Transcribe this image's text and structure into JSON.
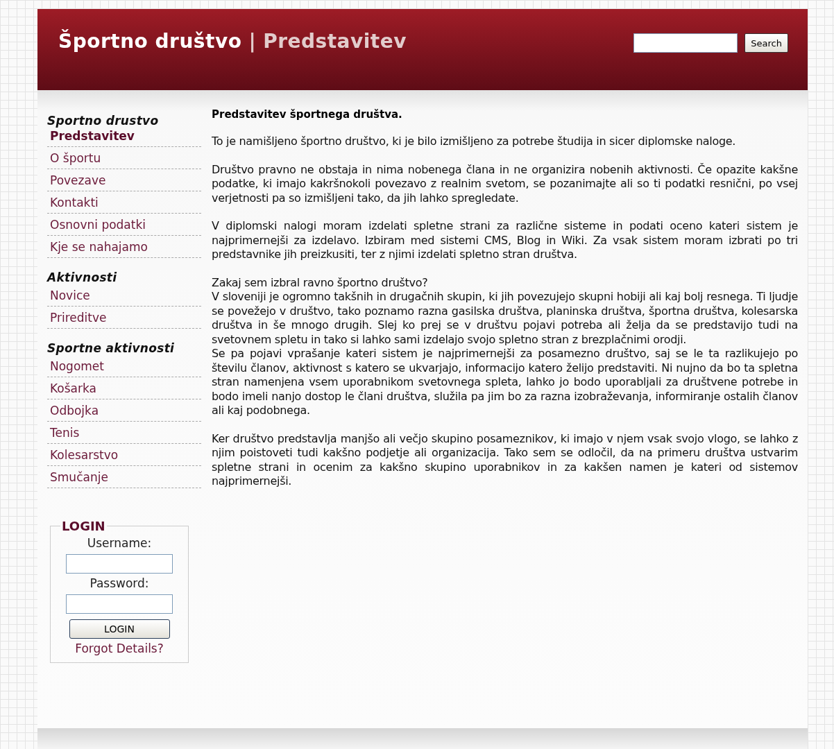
{
  "header": {
    "site_title": "Športno društvo",
    "separator": "|",
    "page_title": "Predstavitev",
    "search": {
      "button": "Search"
    }
  },
  "sidebar": {
    "groups": [
      {
        "title": "Sportno drustvo",
        "items": [
          {
            "label": "Predstavitev",
            "selected": true
          },
          {
            "label": "O športu",
            "selected": false
          },
          {
            "label": "Povezave",
            "selected": false
          },
          {
            "label": "Kontakti",
            "selected": false
          },
          {
            "label": "Osnovni podatki",
            "selected": false
          },
          {
            "label": "Kje se nahajamo",
            "selected": false
          }
        ]
      },
      {
        "title": "Aktivnosti",
        "items": [
          {
            "label": "Novice",
            "selected": false
          },
          {
            "label": "Prireditve",
            "selected": false
          }
        ]
      },
      {
        "title": "Sportne aktivnosti",
        "items": [
          {
            "label": "Nogomet",
            "selected": false
          },
          {
            "label": "Košarka",
            "selected": false
          },
          {
            "label": "Odbojka",
            "selected": false
          },
          {
            "label": "Tenis",
            "selected": false
          },
          {
            "label": "Kolesarstvo",
            "selected": false
          },
          {
            "label": "Smučanje",
            "selected": false
          }
        ]
      }
    ],
    "login": {
      "legend": "LOGIN",
      "username_label": "Username:",
      "password_label": "Password:",
      "button": "LOGIN",
      "forgot_link": "Forgot Details?"
    }
  },
  "content": {
    "heading": "Predstavitev športnega društva.",
    "paragraphs": [
      [
        "To je namišljeno športno društvo, ki je bilo izmišljeno za potrebe študija in sicer diplomske naloge."
      ],
      [
        "Društvo pravno ne obstaja in nima nobenega člana in ne organizira nobenih aktivnosti. Če opazite kakšne podatke, ki imajo kakršnokoli povezavo z realnim svetom, se pozanimajte ali so ti podatki resnični, po vsej verjetnosti pa so izmišljeni tako, da jih lahko spregledate."
      ],
      [
        "V diplomski nalogi moram izdelati spletne strani za različne sisteme in podati oceno kateri sistem je najprimernejši za izdelavo. Izbiram med sistemi CMS, Blog in Wiki. Za vsak sistem moram izbrati po tri predstavnike jih preizkusiti, ter z njimi izdelati spletno stran društva."
      ],
      [
        "Zakaj sem izbral ravno športno društvo?",
        "V sloveniji je ogromno takšnih in drugačnih skupin, ki jih povezujejo skupni hobiji ali kaj bolj resnega. Ti ljudje se povežejo v društvo, tako poznamo razna gasilska društva, planinska društva, športna društva, kolesarska društva in še mnogo drugih. Slej ko prej se v društvu pojavi potreba ali želja da se predstavijo tudi na svetovnem spletu in tako si lahko sami izdelajo svojo spletno stran z brezplačnimi orodji.",
        "Se pa pojavi vprašanje kateri sistem je najprimernejši za posamezno društvo, saj se le ta razlikujejo po številu članov, aktivnost s katero se ukvarjajo, informacijo katero želijo predstaviti. Ni nujno da bo ta spletna stran namenjena vsem uporabnikom svetovnega spleta, lahko jo bodo uporabljali za društvene potrebe in bodo imeli nanjo dostop le člani društva, služila pa jim bo za razna izobraževanja, informiranje ostalih članov ali kaj podobnega."
      ],
      [
        "Ker društvo predstavlja manjšo ali večjo skupino posameznikov, ki imajo v njem vsak svojo vlogo, se lahko z njim poistoveti tudi kakšno podjetje ali organizacija. Tako sem se odločil, da na primeru društva ustvarim spletne strani in ocenim za kakšno skupino uporabnikov in za kakšen namen je kateri od sistemov najprimernejši."
      ]
    ]
  }
}
